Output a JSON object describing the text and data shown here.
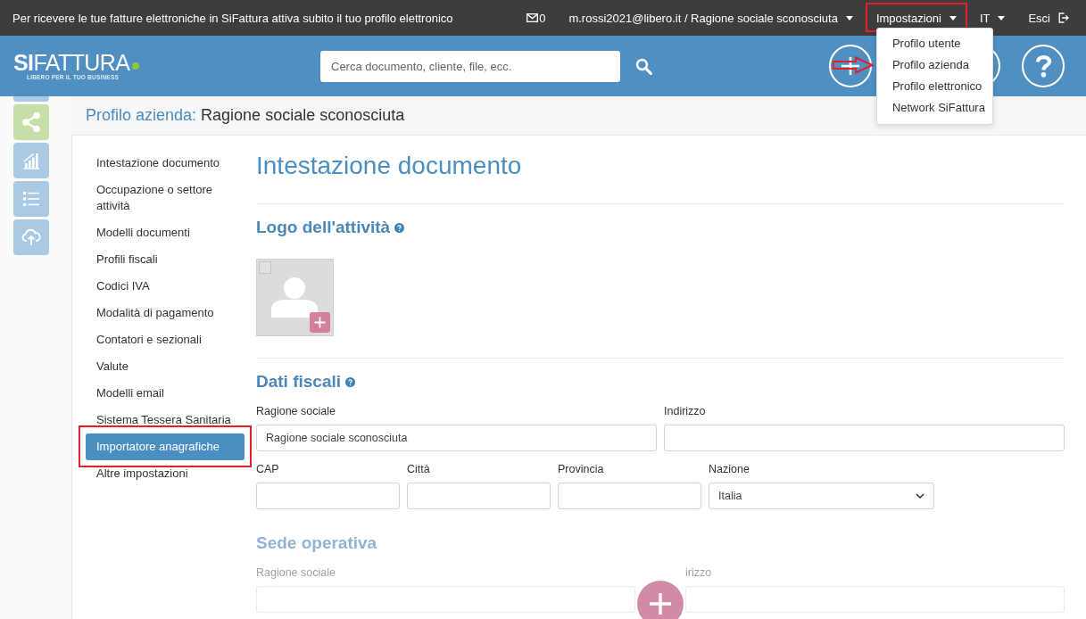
{
  "top_bar": {
    "notice": "Per ricevere le tue fatture elettroniche in SiFattura attiva subito il tuo profilo elettronico",
    "items": [
      {
        "kind": "mail",
        "label": "0",
        "annotated": false
      },
      {
        "kind": "dropdown",
        "label": "m.rossi2021@libero.it / Ragione sociale sconosciuta",
        "annotated": false,
        "expanded": false
      },
      {
        "kind": "dropdown",
        "label": "Impostazioni",
        "annotated": true,
        "expanded": true,
        "items": [
          {
            "label": "Profilo utente",
            "arrow": false
          },
          {
            "label": "Profilo azienda",
            "arrow": true
          },
          {
            "label": "Profilo elettronico",
            "arrow": false
          },
          {
            "label": "Network SiFattura",
            "arrow": false
          }
        ]
      },
      {
        "kind": "dropdown",
        "label": "IT",
        "annotated": false,
        "expanded": false
      },
      {
        "kind": "logout",
        "label": "Esci",
        "annotated": false
      }
    ]
  },
  "header": {
    "logo": {
      "name": "**SI**FATTURA",
      "tagline": "LIBERO PER IL TUO BUSINESS"
    },
    "search": {
      "placeholder": "Cerca documento, cliente, file, ecc."
    },
    "action_buttons": [
      {
        "kind": "add"
      },
      {
        "kind": "covered"
      },
      {
        "kind": "help"
      }
    ]
  },
  "sidebar_tools": [
    {
      "kind": "partial",
      "color": "#a9c9e5"
    },
    {
      "kind": "share",
      "color": "#c7dea8"
    },
    {
      "kind": "chart",
      "color": "#a9c9e5"
    },
    {
      "kind": "list",
      "color": "#a9c9e5"
    },
    {
      "kind": "upload",
      "color": "#a9c9e5"
    }
  ],
  "page_title": {
    "label": "Profilo azienda:",
    "value": "Ragione sociale sconosciuta"
  },
  "settings_nav": [
    {
      "label": "Intestazione documento",
      "selected": false,
      "annotated": false
    },
    {
      "label": "Occupazione o settore attività",
      "selected": false,
      "annotated": false
    },
    {
      "label": "Modelli documenti",
      "selected": false,
      "annotated": false
    },
    {
      "label": "Profili fiscali",
      "selected": false,
      "annotated": false
    },
    {
      "label": "Codici IVA",
      "selected": false,
      "annotated": false
    },
    {
      "label": "Modalità di pagamento",
      "selected": false,
      "annotated": false
    },
    {
      "label": "Contatori e sezionali",
      "selected": false,
      "annotated": false
    },
    {
      "label": "Valute",
      "selected": false,
      "annotated": false
    },
    {
      "label": "Modelli email",
      "selected": false,
      "annotated": false
    },
    {
      "label": "Sistema Tessera Sanitaria",
      "selected": false,
      "annotated": false
    },
    {
      "label": "Importatore anagrafiche",
      "selected": true,
      "annotated": true
    },
    {
      "label": "Altre impostazioni",
      "selected": false,
      "annotated": false
    }
  ],
  "content": {
    "title": "Intestazione documento",
    "sections": [
      {
        "kind": "logo",
        "title": "Logo dell'attività",
        "help": true,
        "checked": false
      },
      {
        "kind": "form",
        "title": "Dati fiscali",
        "help": true,
        "faded": false,
        "rows": [
          [
            {
              "kind": "text",
              "label": "Ragione sociale",
              "value": "Ragione sociale sconosciuta"
            },
            {
              "kind": "text",
              "label": "Indirizzo"
            }
          ],
          [
            {
              "kind": "text",
              "label": "CAP"
            },
            {
              "kind": "text",
              "label": "Città"
            },
            {
              "kind": "text",
              "label": "Provincia"
            },
            {
              "kind": "select",
              "label": "Nazione",
              "value": "Italia"
            }
          ]
        ]
      },
      {
        "kind": "form",
        "title": "Sede operativa",
        "help": false,
        "faded": true,
        "rows": [
          [
            {
              "kind": "text",
              "label": "Ragione sociale"
            },
            {
              "kind": "text",
              "label": "irizzo"
            }
          ]
        ]
      }
    ]
  },
  "floating_button": {
    "kind": "add"
  }
}
